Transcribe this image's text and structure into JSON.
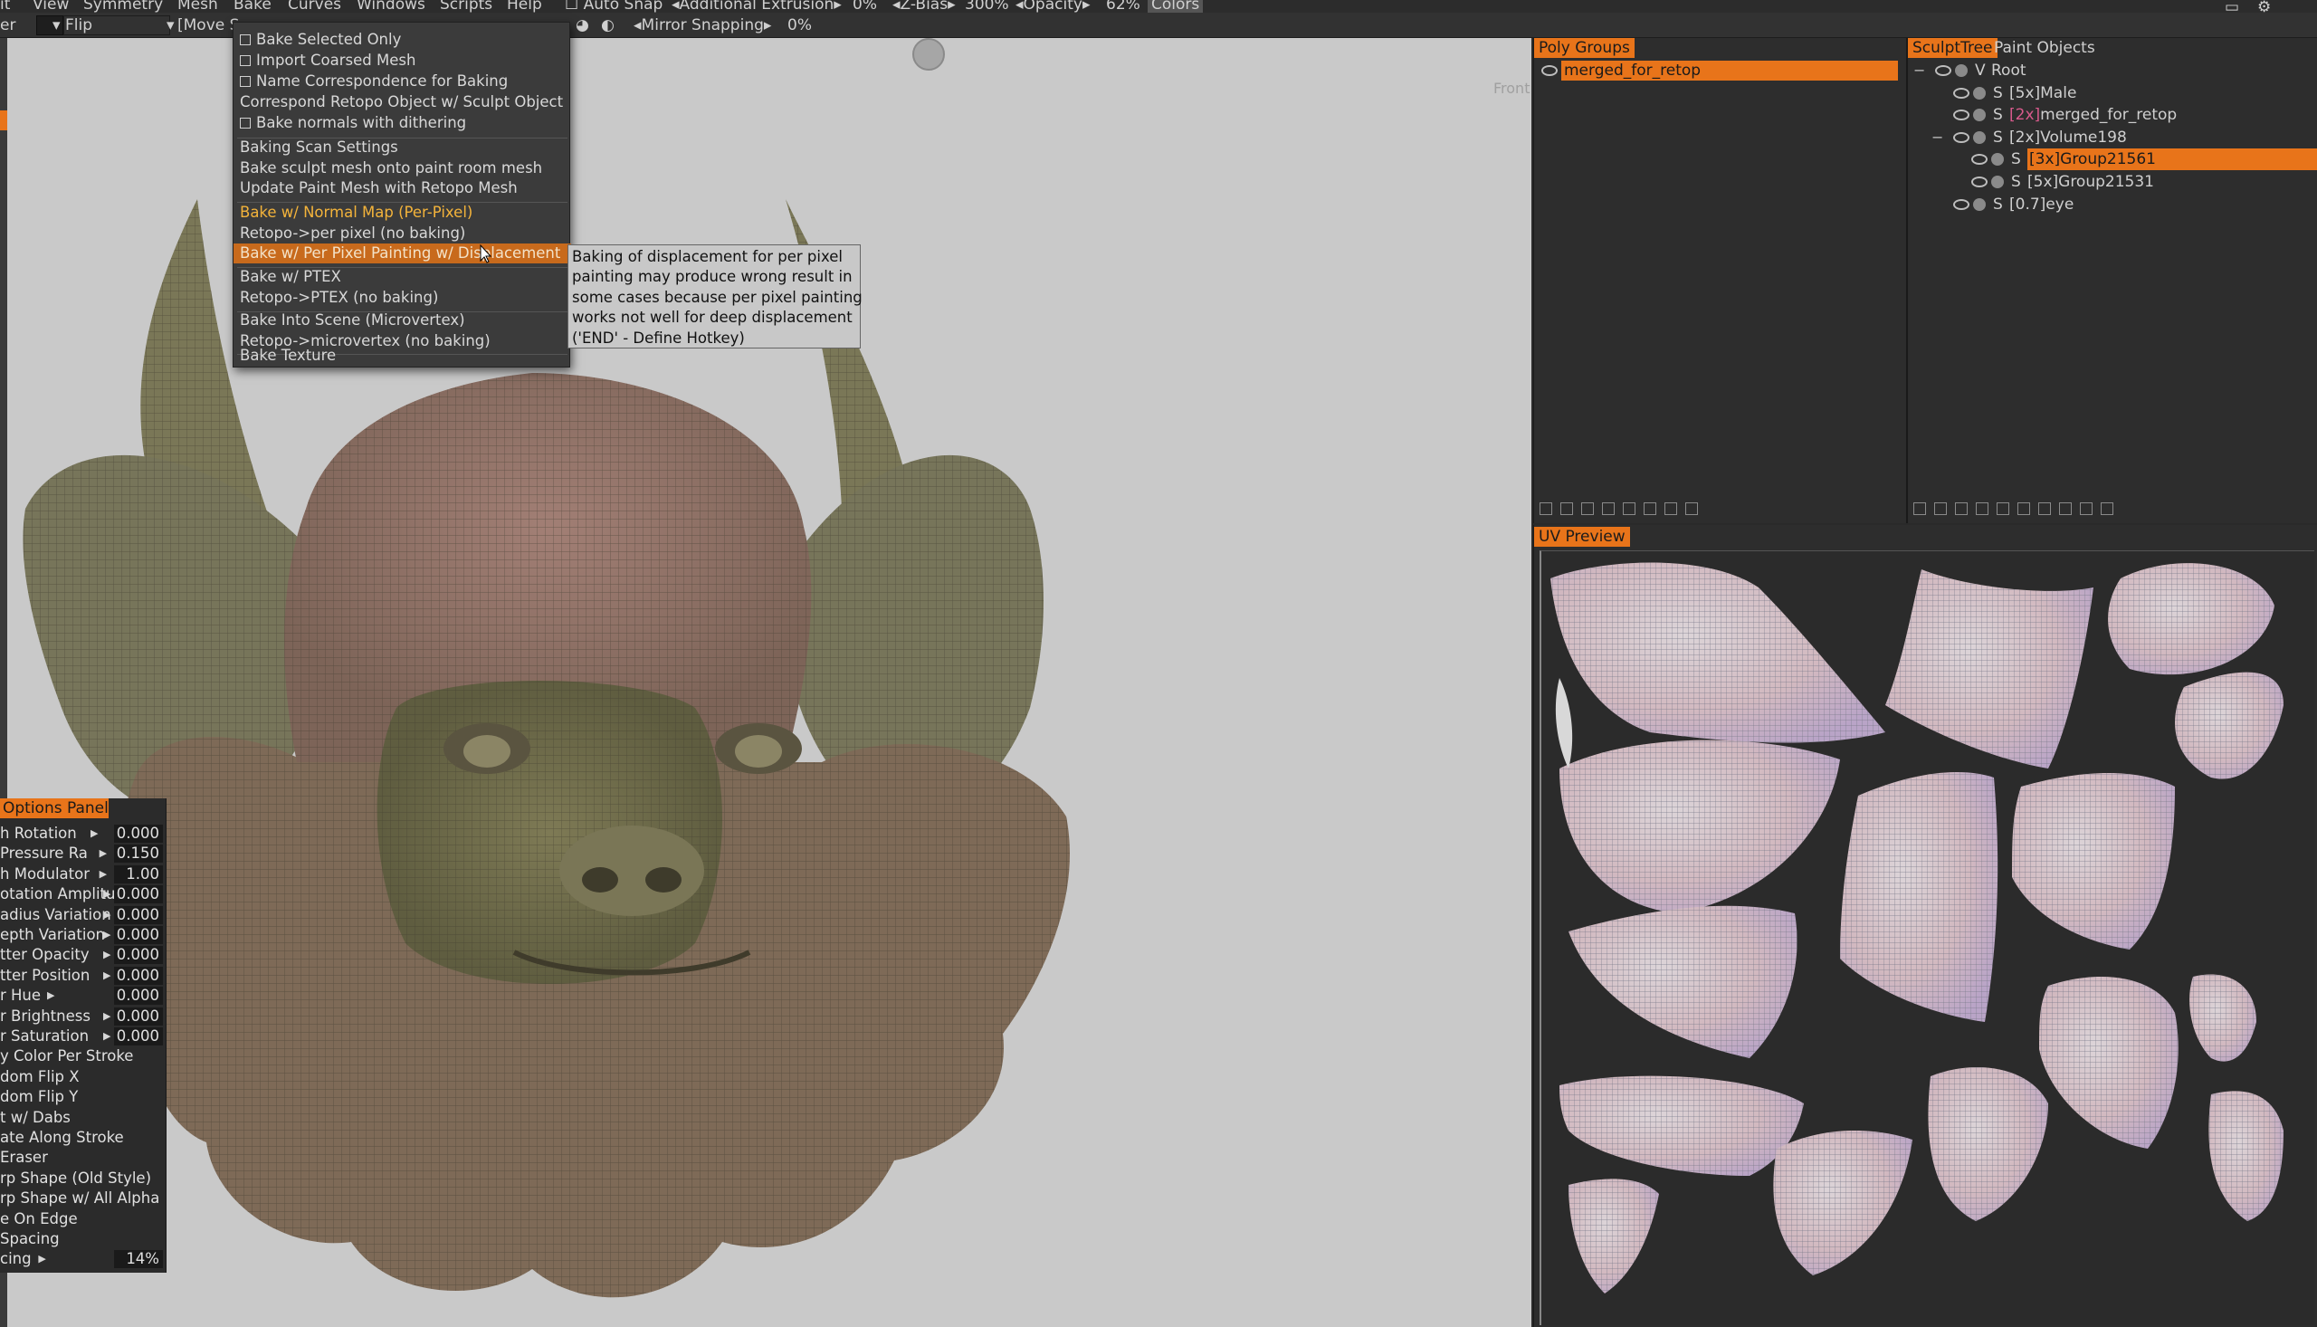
{
  "menubar": {
    "items": [
      "it",
      "View",
      "Symmetry",
      "Mesh",
      "Bake",
      "Curves",
      "Windows",
      "Scripts",
      "Help",
      "Auto Snap",
      "Additional Extrusion",
      "0%",
      "Z-Bias",
      "300%",
      "Opacity",
      "62%",
      "Colors"
    ]
  },
  "toolbar": {
    "left_label": "er",
    "flip_label": "Flip",
    "move_label": "[Move S",
    "mirror_snapping": "Mirror Snapping",
    "mirror_value": "0%"
  },
  "viewport": {
    "nav_label": "Front"
  },
  "bake_menu": {
    "items": [
      {
        "label": "Bake Selected Only",
        "checkbox": true
      },
      {
        "label": "Import Coarsed Mesh",
        "checkbox": true
      },
      {
        "label": "Name Correspondence for Baking",
        "checkbox": true
      },
      {
        "label": "Correspond Retopo Object w/ Sculpt Object",
        "checkbox": false
      },
      {
        "label": "Bake normals with dithering",
        "checkbox": true
      },
      {
        "label": "Baking Scan Settings",
        "checkbox": false
      },
      {
        "label": "Bake sculpt mesh onto paint room mesh",
        "checkbox": false
      },
      {
        "label": "Update Paint Mesh with Retopo Mesh",
        "checkbox": false
      },
      {
        "label": "Bake w/ Normal Map (Per-Pixel)",
        "checkbox": false
      },
      {
        "label": "Retopo->per pixel (no baking)",
        "checkbox": false
      },
      {
        "label": "Bake w/ Per Pixel Painting w/ Displacement",
        "checkbox": false
      },
      {
        "label": "Bake w/ PTEX",
        "checkbox": false
      },
      {
        "label": "Retopo->PTEX (no baking)",
        "checkbox": false
      },
      {
        "label": "Bake Into Scene (Microvertex)",
        "checkbox": false
      },
      {
        "label": "Retopo->microvertex (no baking)",
        "checkbox": false
      },
      {
        "label": "Bake Texture",
        "checkbox": false
      }
    ]
  },
  "tooltip": {
    "lines": [
      "Baking of displacement for per pixel",
      "painting may produce wrong result in",
      "some cases because per pixel painting",
      "works not well for deep displacement",
      "('END' - Define Hotkey)"
    ]
  },
  "options_panel": {
    "title": "Options Panel",
    "rows": [
      {
        "label": "h Rotation",
        "arrow": true,
        "value": "0.000"
      },
      {
        "label": "Pressure Ra",
        "arrow": true,
        "value": "0.150"
      },
      {
        "label": "h Modulator",
        "arrow": true,
        "value": "1.00"
      },
      {
        "label": "otation Amplitu",
        "arrow": true,
        "value": "0.000"
      },
      {
        "label": "adius Variation",
        "arrow": true,
        "value": "0.000"
      },
      {
        "label": "epth Variation",
        "arrow": true,
        "value": "0.000"
      },
      {
        "label": "tter Opacity",
        "arrow": true,
        "value": "0.000"
      },
      {
        "label": "tter Position",
        "arrow": true,
        "value": "0.000"
      },
      {
        "label": "r Hue",
        "arrow": true,
        "value": "0.000"
      },
      {
        "label": "r Brightness",
        "arrow": true,
        "value": "0.000"
      },
      {
        "label": "r Saturation",
        "arrow": true,
        "value": "0.000"
      },
      {
        "label": "y Color Per Stroke",
        "arrow": false,
        "value": null
      },
      {
        "label": "dom Flip X",
        "arrow": false,
        "value": null
      },
      {
        "label": "dom Flip Y",
        "arrow": false,
        "value": null
      },
      {
        "label": "t w/ Dabs",
        "arrow": false,
        "value": null
      },
      {
        "label": "ate Along Stroke",
        "arrow": false,
        "value": null
      },
      {
        "label": "Eraser",
        "arrow": false,
        "value": null
      },
      {
        "label": "rp Shape (Old Style)",
        "arrow": false,
        "value": null
      },
      {
        "label": "rp Shape w/ All Alpha",
        "arrow": false,
        "value": null
      },
      {
        "label": "e On Edge",
        "arrow": false,
        "value": null
      },
      {
        "label": "Spacing",
        "arrow": false,
        "value": null
      },
      {
        "label": "cing",
        "arrow": true,
        "value": "14%"
      }
    ]
  },
  "polygroups": {
    "title": "Poly Groups",
    "item": "merged_for_retop"
  },
  "sculpttree": {
    "tabs": [
      "SculptTree",
      "Paint Objects"
    ],
    "rows": [
      {
        "label": "Root",
        "prefix": "V",
        "indent": 0,
        "selected": false,
        "expand": "−"
      },
      {
        "label": "[5x]Male",
        "prefix": "S",
        "indent": 1,
        "selected": false,
        "expand": ""
      },
      {
        "label": "merged_for_retop",
        "multiplier": "[2x]",
        "prefix": "S",
        "indent": 1,
        "selected": false,
        "expand": ""
      },
      {
        "label": "[2x]Volume198",
        "prefix": "S",
        "indent": 1,
        "selected": false,
        "expand": "−"
      },
      {
        "label": "[3x]Group21561",
        "prefix": "S",
        "indent": 2,
        "selected": true,
        "expand": ""
      },
      {
        "label": "[5x]Group21531",
        "prefix": "S",
        "indent": 2,
        "selected": false,
        "expand": ""
      },
      {
        "label": "[0.7]eye",
        "prefix": "S",
        "indent": 1,
        "selected": false,
        "expand": ""
      }
    ]
  },
  "uvpreview": {
    "title": "UV Preview"
  },
  "colors": {
    "accent": "#e8741a",
    "menu_highlight": "#c86a1c",
    "gold_text": "#f3b33b",
    "viewport_bg": "#c9c9c9"
  }
}
